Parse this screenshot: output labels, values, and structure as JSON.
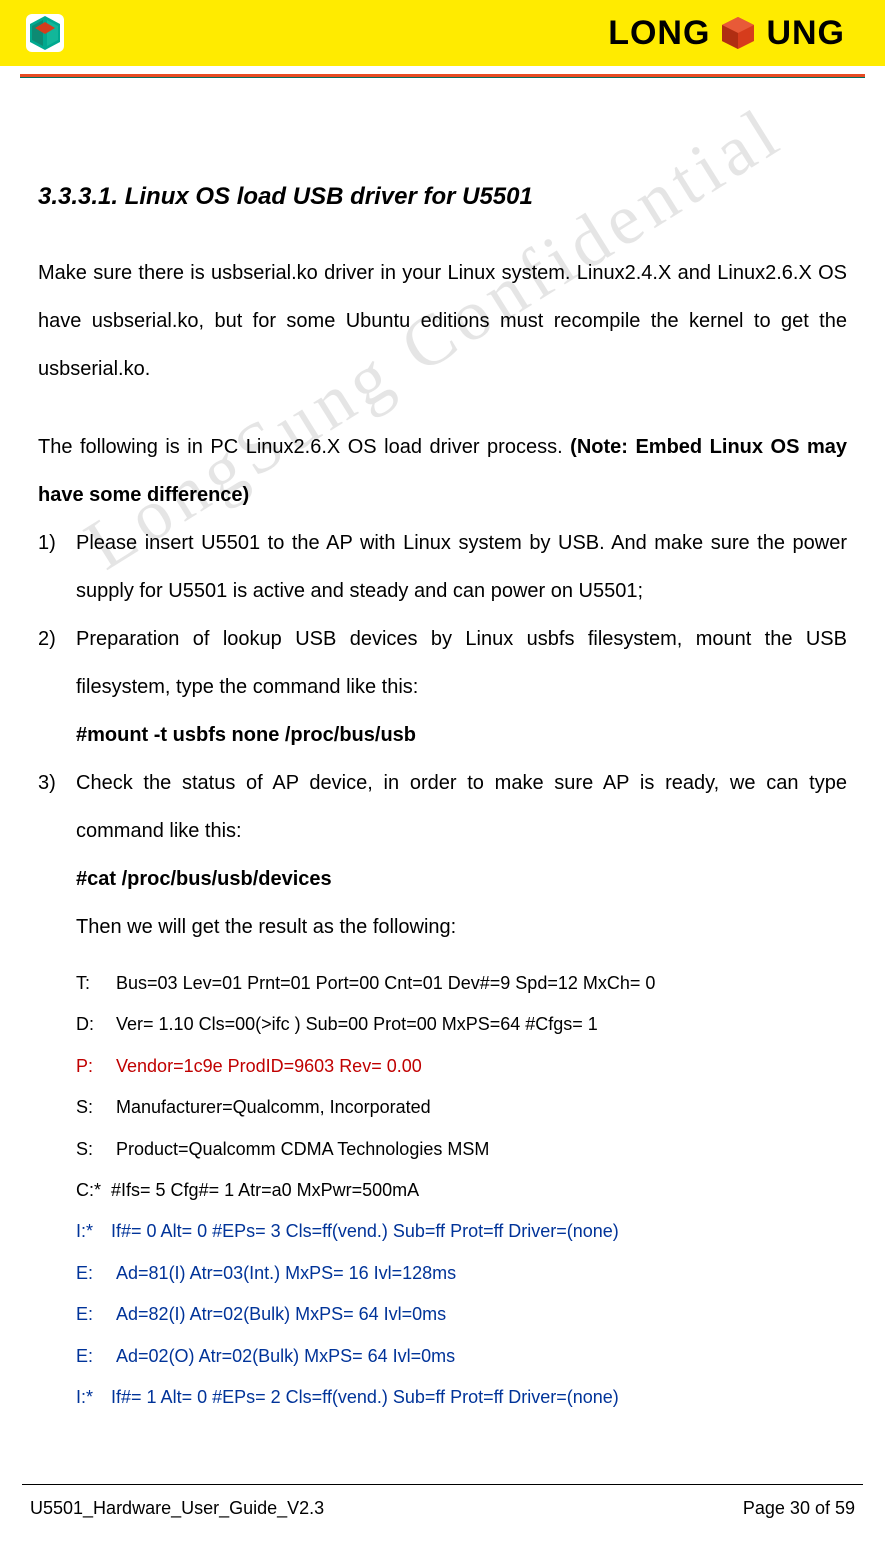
{
  "header": {
    "brand_left_text": "LONG",
    "brand_right_text": "UNG"
  },
  "watermark": "LongSung Confidential",
  "heading": "3.3.3.1. Linux OS load USB driver for U5501",
  "para1": "Make sure there is usbserial.ko driver in your Linux system. Linux2.4.X and Linux2.6.X OS have usbserial.ko, but for some Ubuntu editions must recompile the kernel to get the usbserial.ko.",
  "note_intro": "The following is in PC Linux2.6.X OS load driver process. ",
  "note_bold": "(Note: Embed Linux OS may have some difference)",
  "steps": [
    {
      "num": "1)",
      "text": "Please insert U5501 to the AP with Linux system by USB. And make sure the power supply for U5501 is active and steady and can power on U5501;"
    },
    {
      "num": "2)",
      "text": "Preparation of lookup USB devices by Linux usbfs filesystem, mount the USB filesystem, type the command like this:",
      "cmd": "#mount -t usbfs none /proc/bus/usb"
    },
    {
      "num": "3)",
      "text": "Check the status of AP device, in order to make sure AP is ready, we can type command like this:",
      "cmd": "#cat /proc/bus/usb/devices",
      "after": "Then we will get the result as the following:"
    }
  ],
  "device_output": [
    {
      "prefix": "T:",
      "text": "Bus=03 Lev=01 Prnt=01 Port=00 Cnt=01 Dev#=9 Spd=12 MxCh= 0",
      "color": "black"
    },
    {
      "prefix": "D:",
      "text": " Ver= 1.10 Cls=00(>ifc ) Sub=00 Prot=00 MxPS=64 #Cfgs=   1",
      "color": "black"
    },
    {
      "prefix": "P:",
      "text": "Vendor=1c9e ProdID=9603 Rev= 0.00",
      "color": "red"
    },
    {
      "prefix": "S:",
      "text": "Manufacturer=Qualcomm, Incorporated",
      "color": "black"
    },
    {
      "prefix": "S:",
      "text": "Product=Qualcomm CDMA Technologies MSM",
      "color": "black"
    },
    {
      "prefix": "C:*",
      "text": "#Ifs= 5 Cfg#= 1 Atr=a0 MxPwr=500mA",
      "color": "black"
    },
    {
      "prefix": "I:*",
      "text": "If#= 0 Alt= 0 #EPs= 3 Cls=ff(vend.) Sub=ff Prot=ff Driver=(none)",
      "color": "blue"
    },
    {
      "prefix": "E:",
      "text": "Ad=81(I) Atr=03(Int.) MxPS=   16 Ivl=128ms",
      "color": "blue"
    },
    {
      "prefix": "E:",
      "text": "Ad=82(I) Atr=02(Bulk) MxPS=   64 Ivl=0ms",
      "color": "blue"
    },
    {
      "prefix": "E:",
      "text": "Ad=02(O) Atr=02(Bulk) MxPS=   64 Ivl=0ms",
      "color": "blue"
    },
    {
      "prefix": "I:*",
      "text": "If#= 1 Alt= 0 #EPs= 2 Cls=ff(vend.) Sub=ff Prot=ff Driver=(none)",
      "color": "blue"
    }
  ],
  "footer": {
    "left": "U5501_Hardware_User_Guide_V2.3",
    "right": "Page 30 of 59"
  }
}
